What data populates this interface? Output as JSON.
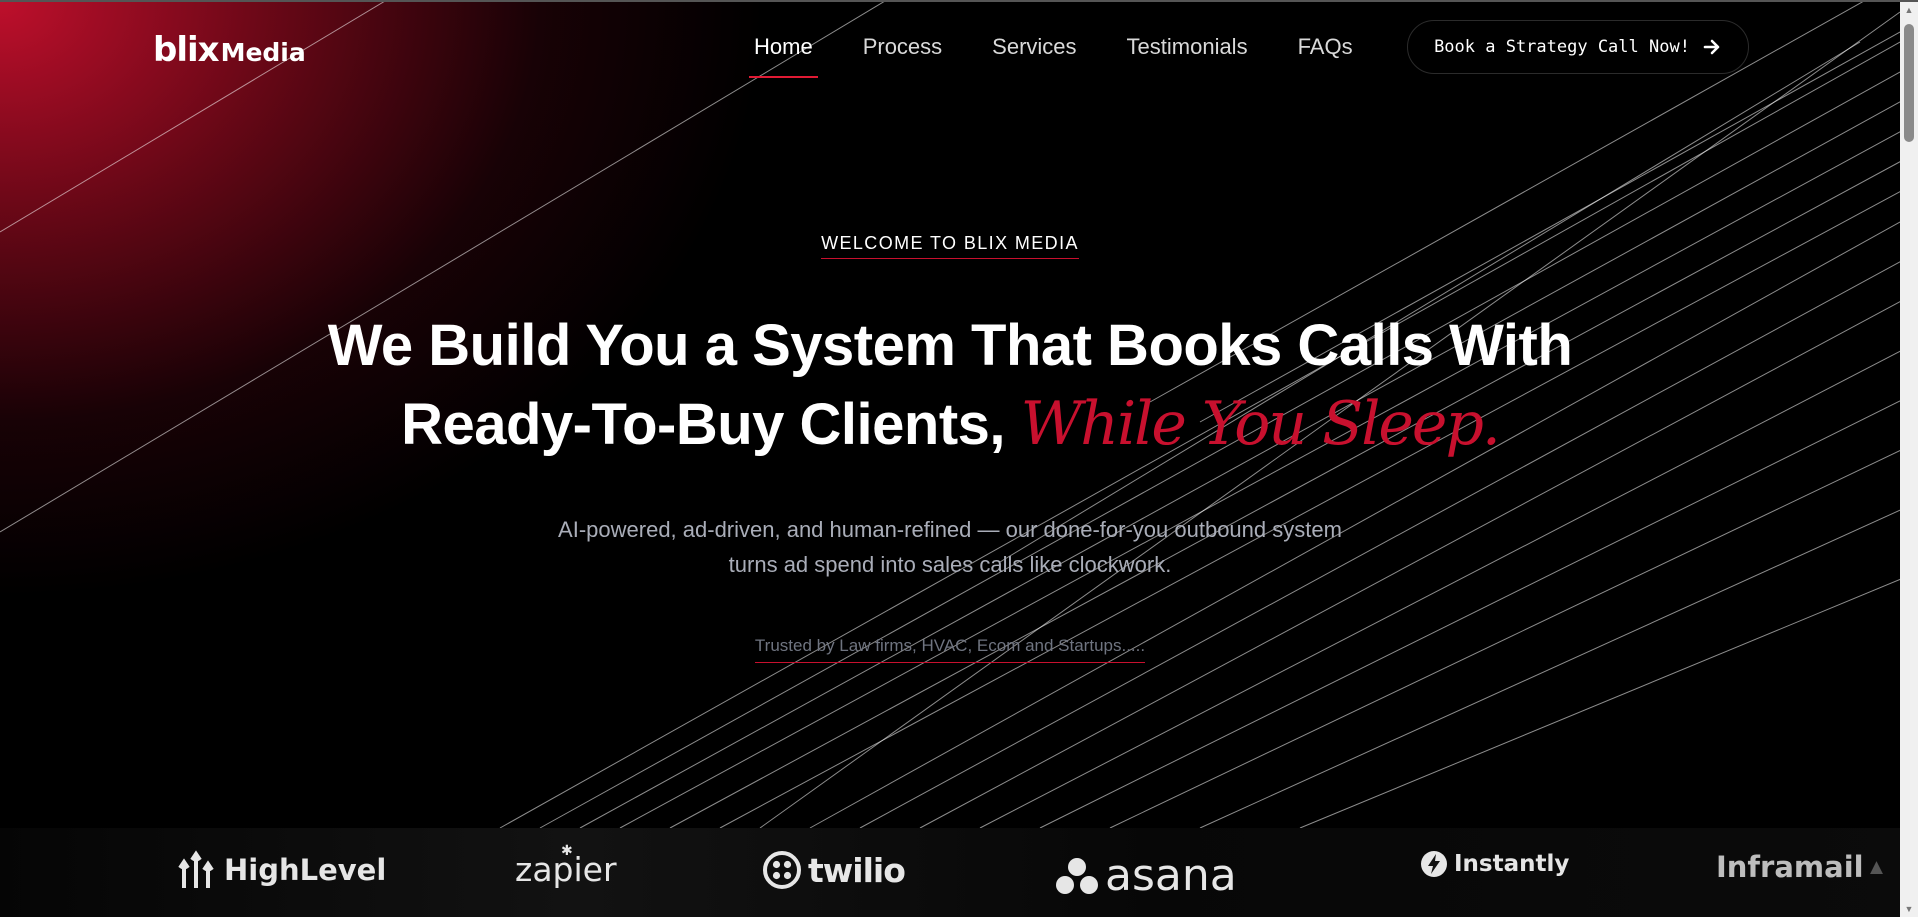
{
  "brand": {
    "logo_part1": "blix",
    "logo_part2": "Media"
  },
  "nav": {
    "items": [
      {
        "label": "Home",
        "active": true
      },
      {
        "label": "Process",
        "active": false
      },
      {
        "label": "Services",
        "active": false
      },
      {
        "label": "Testimonials",
        "active": false
      },
      {
        "label": "FAQs",
        "active": false
      }
    ],
    "cta_label": "Book a Strategy Call Now!"
  },
  "hero": {
    "eyebrow": "WELCOME TO BLIX MEDIA",
    "headline_line1": "We Build You a System That Books Calls With",
    "headline_line2": "Ready-To-Buy Clients,",
    "headline_accent": "While You Sleep.",
    "subtext_line1": "AI-powered, ad-driven, and human-refined — our done-for-you outbound system",
    "subtext_line2": "turns ad spend into sales calls like clockwork.",
    "trusted": "Trusted by Law firms, HVAC, Ecom and Startups....."
  },
  "partners": [
    {
      "name": "HighLevel",
      "icon": "highlevel-icon"
    },
    {
      "name": "zapier",
      "icon": "zapier-icon"
    },
    {
      "name": "twilio",
      "icon": "twilio-icon"
    },
    {
      "name": "asana",
      "icon": "asana-icon"
    },
    {
      "name": "Instantly",
      "icon": "instantly-icon"
    },
    {
      "name": "Inframail",
      "icon": "inframail-icon"
    }
  ],
  "colors": {
    "accent": "#c8102e",
    "background": "#000000",
    "muted_text": "#a9adb8"
  }
}
